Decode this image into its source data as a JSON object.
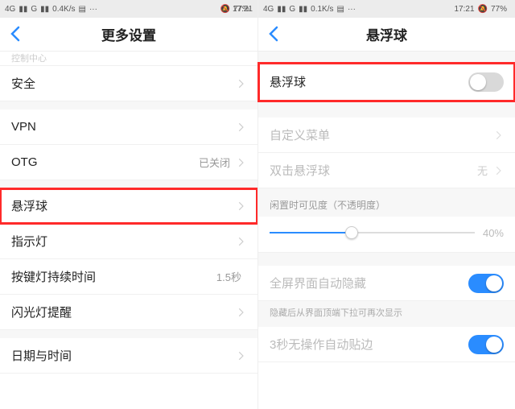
{
  "status": {
    "left1": "4G",
    "left2": "G",
    "speed_a": "0.4K/s",
    "speed_b": "0.1K/s",
    "time": "17:21",
    "battery_pct": "77%",
    "bell_off_glyph": "🔕"
  },
  "left": {
    "title": "更多设置",
    "partial_top": "控制中心",
    "items": {
      "security": "安全",
      "vpn": "VPN",
      "otg": "OTG",
      "otg_value": "已关闭",
      "float_ball": "悬浮球",
      "indicator": "指示灯",
      "keylight": "按键灯持续时间",
      "keylight_value": "1.5秒",
      "flash_alert": "闪光灯提醒",
      "datetime": "日期与时间"
    }
  },
  "right": {
    "title": "悬浮球",
    "toggle_label": "悬浮球",
    "custom_menu": "自定义菜单",
    "double_tap": "双击悬浮球",
    "double_tap_value": "无",
    "opacity_header": "闲置时可见度（不透明度）",
    "opacity_value": "40%",
    "auto_hide": "全屏界面自动隐藏",
    "auto_hide_hint": "隐藏后从界面顶端下拉可再次显示",
    "snap_edge": "3秒无操作自动贴边"
  },
  "slider": {
    "pct": 40
  }
}
